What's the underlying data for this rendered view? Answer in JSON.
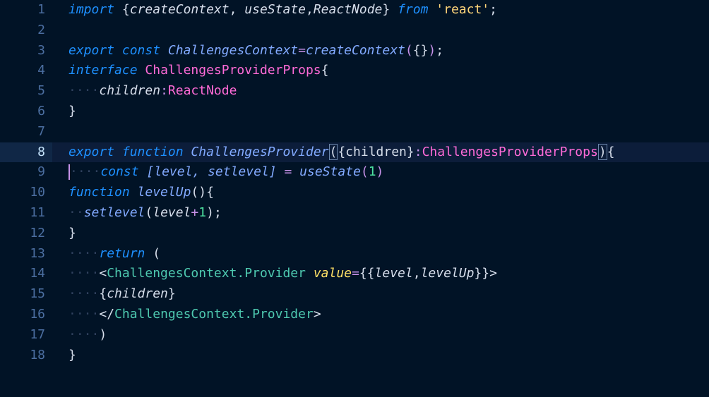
{
  "editor": {
    "current_line": 8,
    "lines": [
      {
        "n": "1",
        "tokens": [
          {
            "t": "import",
            "c": "kw"
          },
          {
            "t": " ",
            "c": "pl"
          },
          {
            "t": "{",
            "c": "pl"
          },
          {
            "t": "createContext",
            "c": "it"
          },
          {
            "t": ", ",
            "c": "pl"
          },
          {
            "t": "useState",
            "c": "it"
          },
          {
            "t": ",",
            "c": "pl"
          },
          {
            "t": "ReactNode",
            "c": "it"
          },
          {
            "t": "}",
            "c": "pl"
          },
          {
            "t": " ",
            "c": "pl"
          },
          {
            "t": "from",
            "c": "kw"
          },
          {
            "t": " ",
            "c": "pl"
          },
          {
            "t": "'react'",
            "c": "str"
          },
          {
            "t": ";",
            "c": "pl"
          }
        ]
      },
      {
        "n": "2",
        "tokens": []
      },
      {
        "n": "3",
        "tokens": [
          {
            "t": "export",
            "c": "kw"
          },
          {
            "t": " ",
            "c": "pl"
          },
          {
            "t": "const",
            "c": "kw"
          },
          {
            "t": " ",
            "c": "pl"
          },
          {
            "t": "ChallengesContext",
            "c": "fnb"
          },
          {
            "t": "=",
            "c": "op"
          },
          {
            "t": "createContext",
            "c": "fnb"
          },
          {
            "t": "(",
            "c": "op"
          },
          {
            "t": "{}",
            "c": "pl"
          },
          {
            "t": ")",
            "c": "op"
          },
          {
            "t": ";",
            "c": "pl"
          }
        ]
      },
      {
        "n": "4",
        "tokens": [
          {
            "t": "interface",
            "c": "kw"
          },
          {
            "t": " ",
            "c": "pl"
          },
          {
            "t": "ChallengesProviderProps",
            "c": "ty"
          },
          {
            "t": "{",
            "c": "pl"
          }
        ]
      },
      {
        "n": "5",
        "tokens": [
          {
            "t": "····",
            "c": "ws"
          },
          {
            "t": "children",
            "c": "it"
          },
          {
            "t": ":",
            "c": "op"
          },
          {
            "t": "ReactNode",
            "c": "ty"
          }
        ]
      },
      {
        "n": "6",
        "tokens": [
          {
            "t": "}",
            "c": "pl"
          }
        ]
      },
      {
        "n": "7",
        "tokens": []
      },
      {
        "n": "8",
        "tokens": [
          {
            "t": "export",
            "c": "kw"
          },
          {
            "t": " ",
            "c": "pl"
          },
          {
            "t": "function",
            "c": "kw"
          },
          {
            "t": " ",
            "c": "pl"
          },
          {
            "t": "ChallengesProvider",
            "c": "fnb"
          },
          {
            "t": "(",
            "c": "brk"
          },
          {
            "t": "{children}",
            "c": "pl"
          },
          {
            "t": ":",
            "c": "op"
          },
          {
            "t": "ChallengesProviderProps",
            "c": "ty"
          },
          {
            "t": ")",
            "c": "brk"
          },
          {
            "t": "{",
            "c": "pl"
          }
        ]
      },
      {
        "n": "9",
        "tokens": [
          {
            "t": "caret",
            "c": "caret"
          },
          {
            "t": "····",
            "c": "ws"
          },
          {
            "t": "const",
            "c": "kw"
          },
          {
            "t": " ",
            "c": "pl"
          },
          {
            "t": "[level, setlevel]",
            "c": "fnb"
          },
          {
            "t": " ",
            "c": "pl"
          },
          {
            "t": "=",
            "c": "op"
          },
          {
            "t": " ",
            "c": "pl"
          },
          {
            "t": "useState",
            "c": "fnb"
          },
          {
            "t": "(",
            "c": "op"
          },
          {
            "t": "1",
            "c": "num"
          },
          {
            "t": ")",
            "c": "op"
          }
        ]
      },
      {
        "n": "10",
        "tokens": [
          {
            "t": "function",
            "c": "kw"
          },
          {
            "t": " ",
            "c": "pl"
          },
          {
            "t": "levelUp",
            "c": "fnb"
          },
          {
            "t": "(){",
            "c": "pl"
          }
        ]
      },
      {
        "n": "11",
        "tokens": [
          {
            "t": "··",
            "c": "ws"
          },
          {
            "t": "setlevel",
            "c": "fnb"
          },
          {
            "t": "(",
            "c": "pl"
          },
          {
            "t": "level",
            "c": "it"
          },
          {
            "t": "+",
            "c": "op"
          },
          {
            "t": "1",
            "c": "num"
          },
          {
            "t": ");",
            "c": "pl"
          }
        ]
      },
      {
        "n": "12",
        "tokens": [
          {
            "t": "}",
            "c": "pl"
          }
        ]
      },
      {
        "n": "13",
        "tokens": [
          {
            "t": "····",
            "c": "ws"
          },
          {
            "t": "return",
            "c": "kw"
          },
          {
            "t": " ",
            "c": "pl"
          },
          {
            "t": "(",
            "c": "pl"
          },
          {
            "t": " ",
            "c": "pl"
          }
        ]
      },
      {
        "n": "14",
        "tokens": [
          {
            "t": "····",
            "c": "ws"
          },
          {
            "t": "<",
            "c": "pl"
          },
          {
            "t": "ChallengesContext.Provider",
            "c": "teal"
          },
          {
            "t": " ",
            "c": "pl"
          },
          {
            "t": "value",
            "c": "attr"
          },
          {
            "t": "=",
            "c": "op"
          },
          {
            "t": "{{",
            "c": "pl"
          },
          {
            "t": "level",
            "c": "it"
          },
          {
            "t": ",",
            "c": "pl"
          },
          {
            "t": "levelUp",
            "c": "it"
          },
          {
            "t": "}}>",
            "c": "pl"
          }
        ]
      },
      {
        "n": "15",
        "tokens": [
          {
            "t": "····",
            "c": "ws"
          },
          {
            "t": "{",
            "c": "pl"
          },
          {
            "t": "children",
            "c": "it"
          },
          {
            "t": "}",
            "c": "pl"
          }
        ]
      },
      {
        "n": "16",
        "tokens": [
          {
            "t": "····",
            "c": "ws"
          },
          {
            "t": "</",
            "c": "pl"
          },
          {
            "t": "ChallengesContext.Provider",
            "c": "teal"
          },
          {
            "t": ">",
            "c": "pl"
          }
        ]
      },
      {
        "n": "17",
        "tokens": [
          {
            "t": "····",
            "c": "ws"
          },
          {
            "t": ")",
            "c": "pl"
          }
        ]
      },
      {
        "n": "18",
        "tokens": [
          {
            "t": "}",
            "c": "pl"
          }
        ]
      }
    ]
  },
  "colors": {
    "background": "#011326",
    "current_line": "#0c1d3a",
    "line_number": "#4b6ea0",
    "keyword": "#1e90ff",
    "type": "#ff6bd8",
    "string": "#ffd67a",
    "number": "#4de3a0"
  }
}
